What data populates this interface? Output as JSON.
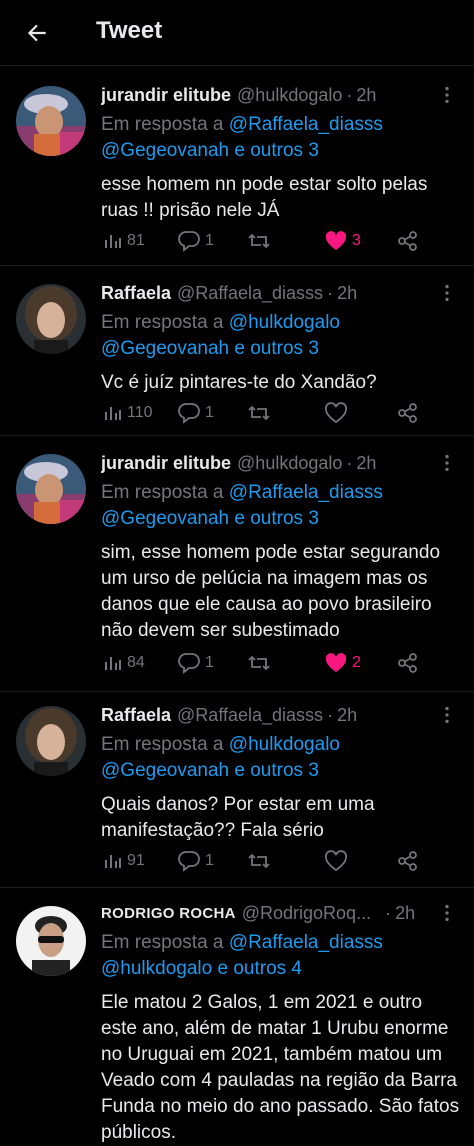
{
  "header": {
    "title": "Tweet"
  },
  "tweets": [
    {
      "name": "jurandir elitube",
      "handle": "@hulkdogalo",
      "sep": "·",
      "time": "2h",
      "reply_prefix": "Em resposta a",
      "mention1": "@Raffaela_diasss",
      "mention2": "@Gegeovanah",
      "reply_suffix": "e outros 3",
      "text": "esse homem nn pode estar solto pelas ruas !! prisão nele JÁ",
      "views": "81",
      "replies": "1",
      "retweets": "",
      "likes": "3",
      "liked": true
    },
    {
      "name": "Raffaela",
      "handle": "@Raffaela_diasss",
      "sep": "·",
      "time": "2h",
      "reply_prefix": "Em resposta a",
      "mention1": "@hulkdogalo",
      "mention2": "@Gegeovanah",
      "reply_suffix": "e outros 3",
      "text": "Vc é juíz pintares-te do Xandão?",
      "views": "110",
      "replies": "1",
      "retweets": "",
      "likes": "",
      "liked": false
    },
    {
      "name": "jurandir elitube",
      "handle": "@hulkdogalo",
      "sep": "·",
      "time": "2h",
      "reply_prefix": "Em resposta a",
      "mention1": "@Raffaela_diasss",
      "mention2": "@Gegeovanah",
      "reply_suffix": "e outros 3",
      "text": "sim, esse homem pode estar segurando um urso de pelúcia na imagem mas os danos que ele causa ao povo brasileiro não devem ser subestimado",
      "views": "84",
      "replies": "1",
      "retweets": "",
      "likes": "2",
      "liked": true
    },
    {
      "name": "Raffaela",
      "handle": "@Raffaela_diasss",
      "sep": "·",
      "time": "2h",
      "reply_prefix": "Em resposta a",
      "mention1": "@hulkdogalo",
      "mention2": "@Gegeovanah",
      "reply_suffix": "e outros 3",
      "text": "Quais danos? Por estar em uma manifestação?? Fala sério",
      "views": "91",
      "replies": "1",
      "retweets": "",
      "likes": "",
      "liked": false
    },
    {
      "name": "RODRIGO ROCHA",
      "handle": "@RodrigoRoq...",
      "sep": "·",
      "time": "2h",
      "reply_prefix": "Em resposta a",
      "mention1": "@Raffaela_diasss",
      "mention2": "@hulkdogalo",
      "reply_suffix": "e outros 4",
      "text": "Ele matou 2 Galos, 1 em 2021 e outro este ano, além de matar 1 Urubu enorme no Uruguai em 2021, também matou um Veado com 4 pauladas na região da Barra Funda no meio do ano passado. São fatos públicos."
    }
  ],
  "icons": {
    "back": "back-arrow-icon",
    "views": "views-chart-icon",
    "reply": "reply-bubble-icon",
    "retweet": "retweet-icon",
    "like": "heart-icon",
    "share": "share-icon",
    "more": "more-dots-icon"
  },
  "colors": {
    "background": "#000000",
    "text": "#e7e9ea",
    "muted": "#71767b",
    "link": "#1d9bf0",
    "like": "#f91880"
  }
}
